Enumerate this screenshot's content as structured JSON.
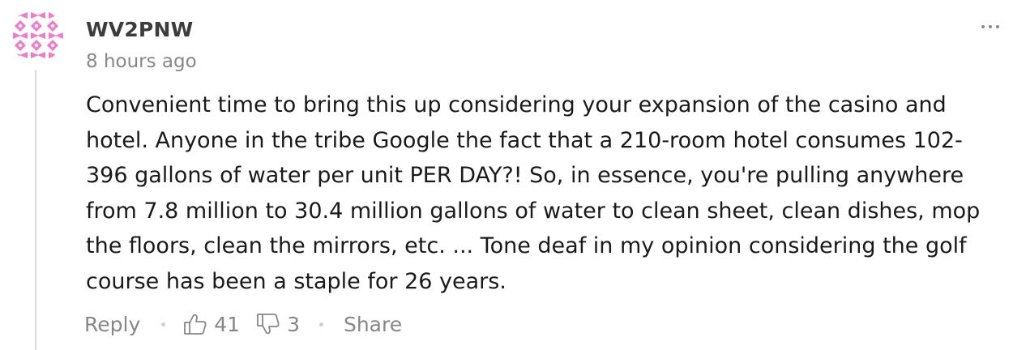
{
  "comment": {
    "username": "WV2PNW",
    "timestamp": "8 hours ago",
    "body": "Convenient time to bring this up considering your expansion of the casino and hotel. Anyone in the tribe Google the fact that a 210-room hotel consumes 102-396 gallons of water per unit PER DAY?! So, in essence, you're pulling anywhere from 7.8 million to 30.4 million gallons of water to clean sheet, clean dishes, mop the floors, clean the mirrors, etc. ... Tone deaf in my opinion considering the golf course has been a staple for 26 years.",
    "avatar_color": "#f07bc8"
  },
  "actions": {
    "reply_label": "Reply",
    "upvotes": "41",
    "downvotes": "3",
    "share_label": "Share"
  },
  "icons": {
    "more": "more-horizontal-icon",
    "upvote": "thumbs-up-icon",
    "downvote": "thumbs-down-icon"
  },
  "colors": {
    "username": "#3c3c3c",
    "meta_text": "#878787",
    "body_text": "#1a1a1a",
    "thread_line": "#dcdcdc"
  }
}
